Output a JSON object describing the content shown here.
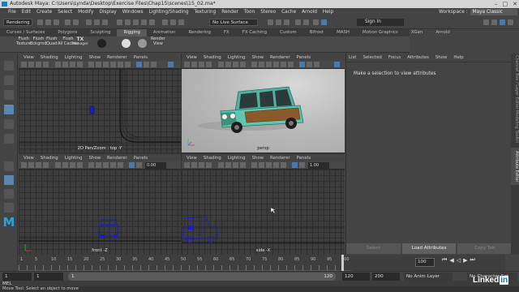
{
  "window": {
    "title": "Autodesk Maya: C:\\Users\\Lynda\\Desktop\\Exercise Files\\Chap15\\scenes\\15_02.ma*",
    "controls": [
      "–",
      "□",
      "✕"
    ]
  },
  "menubar": {
    "items": [
      "File",
      "Edit",
      "Create",
      "Select",
      "Modify",
      "Display",
      "Windows",
      "Lighting/Shading",
      "Texturing",
      "Render",
      "Toon",
      "Stereo",
      "Cache",
      "Arnold",
      "Help"
    ],
    "workspace_label": "Workspace :",
    "workspace_value": "Maya Classic"
  },
  "statusline": {
    "menuset": "Rendering",
    "live_surface": "No Live Surface",
    "sign_in": "Sign In"
  },
  "shelf": {
    "tabs": [
      "Curves / Surfaces",
      "Polygons",
      "Sculpting",
      "Rigging",
      "Animation",
      "Rendering",
      "FX",
      "FX Caching",
      "Custom",
      "Bifrost",
      "MASH",
      "Motion Graphics",
      "XGen",
      "Arnold"
    ],
    "active_tab": "Rigging",
    "buttons": [
      {
        "line1": "Flush",
        "line2": "Texture"
      },
      {
        "line1": "Flush",
        "line2": "Bckgrnd"
      },
      {
        "line1": "Flush",
        "line2": "Quad"
      },
      {
        "line1": "Flush",
        "line2": "All Caches"
      },
      {
        "line1": "TX",
        "line2": "Manager"
      },
      {
        "line1": "",
        "line2": ""
      },
      {
        "line1": "",
        "line2": ""
      },
      {
        "line1": "Render",
        "line2": "View"
      }
    ]
  },
  "viewport_menu": [
    "View",
    "Shading",
    "Lighting",
    "Show",
    "Renderer",
    "Panels"
  ],
  "viewport_fields": {
    "near": "0.00",
    "far": "1.00"
  },
  "viewports": {
    "top": {
      "label": "2D Pan/Zoom : top -Y"
    },
    "persp": {
      "label": "persp"
    },
    "front": {
      "label": "front -Z"
    },
    "side": {
      "label": "side -X"
    }
  },
  "attribute_editor": {
    "menu": [
      "List",
      "Selected",
      "Focus",
      "Attributes",
      "Show",
      "Help"
    ],
    "message": "Make a selection to view attributes",
    "buttons": [
      "Select",
      "Load Attributes",
      "Copy Tab"
    ]
  },
  "side_tabs": [
    "Channel Box / Layer Editor",
    "Modeling Toolkit",
    "Attribute Editor"
  ],
  "timeline": {
    "tick_labels": [
      "1",
      "5",
      "10",
      "15",
      "20",
      "25",
      "30",
      "35",
      "40",
      "45",
      "50",
      "55",
      "60",
      "65",
      "70",
      "75",
      "80",
      "85",
      "90",
      "95",
      "100"
    ],
    "current_frame": "100",
    "right_field": "100"
  },
  "range": {
    "start": "1",
    "playback_start": "1",
    "field_1": "1",
    "field_2": "120",
    "playback_end": "120",
    "end": "200",
    "anim_layer": "No Anim Layer",
    "character_set": "No Character Set"
  },
  "mel_label": "MEL",
  "help_line": "Move Tool: Select an object to move",
  "watermark": "Linked in",
  "colors": {
    "car_body": "#5fc6b2",
    "car_wood": "#8b5a2b",
    "accent": "#5b86b0",
    "maya_logo": "#2aa3d8"
  }
}
